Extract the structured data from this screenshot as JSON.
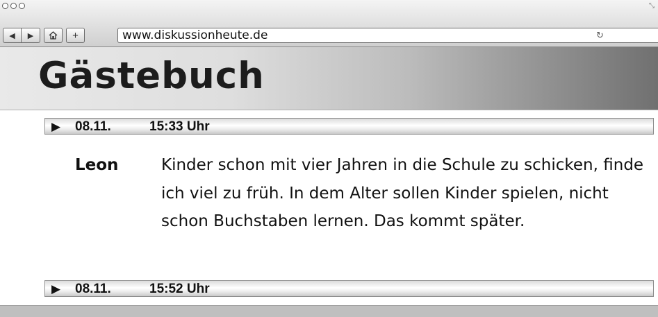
{
  "browser": {
    "url": "www.diskussionheute.de",
    "icons": {
      "back": "back-icon",
      "forward": "forward-icon",
      "home": "home-icon",
      "add": "plus-icon",
      "reload": "reload-icon",
      "resize": "resize-icon"
    }
  },
  "page": {
    "title": "Gästebuch"
  },
  "entries": [
    {
      "date": "08.11.",
      "time": "15:33 Uhr",
      "author": "Leon",
      "text": "Kinder schon mit vier Jahren in die Schule zu schicken, finde ich viel zu früh. In dem Alter sollen Kinder spielen, nicht schon Buchstaben lernen. Das kommt später."
    },
    {
      "date": "08.11.",
      "time": "15:52 Uhr"
    }
  ],
  "colors": {
    "header_gradient_start": "#e9e9e9",
    "header_gradient_end": "#707070",
    "text": "#111111"
  }
}
